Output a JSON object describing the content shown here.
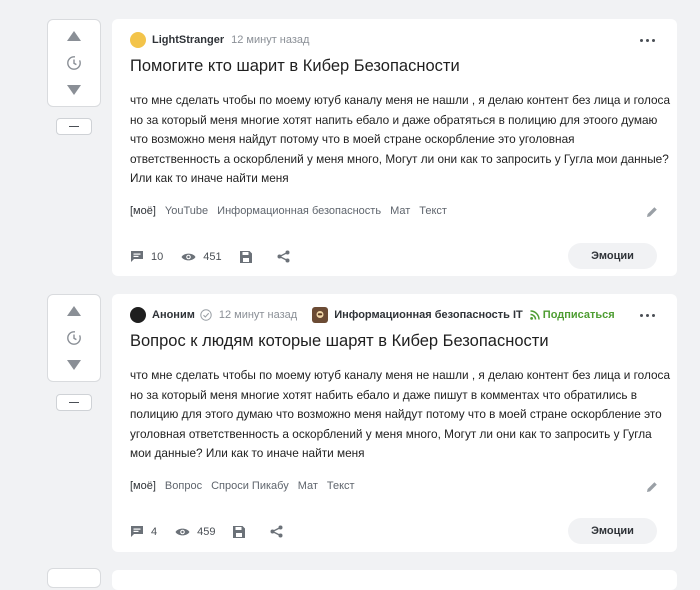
{
  "posts": [
    {
      "author": "LightStranger",
      "time": "12 минут назад",
      "title": "Помогите кто шарит в Кибер Безопасности",
      "lines": [
        "что мне сделать чтобы по моему ютуб каналу меня не нашли , я делаю контент без лица и голоса",
        "но за который меня многие хотят напить ебало и даже обратяться в полицию для этоого думаю",
        "что возможно меня найдут потому что в моей стране оскорбление это уголовная",
        "ответственность а оскорблений у меня много, Могут ли они как то запросить у Гугла мои данные?",
        "Или как то иначе найти меня"
      ],
      "tags": [
        "[моё]",
        "YouTube",
        "Информационная безопасность",
        "Мат",
        "Текст"
      ],
      "comments": "10",
      "views": "451",
      "emotions_label": "Эмоции"
    },
    {
      "author": "Аноним",
      "time": "12 минут назад",
      "community": "Информационная безопасность IT",
      "subscribe": "Подписаться",
      "title": "Вопрос к людям которые шарят в Кибер Безопасности",
      "lines": [
        "что мне сделать чтобы по моему ютуб каналу меня не нашли , я делаю контент без лица и голоса",
        "но за который меня многие хотят набить ебало и даже пишут в комментах что обратились в",
        "полицию для этого думаю что возможно меня найдут потому что в моей стране оскорбление это",
        "уголовная ответственность а оскорблений у меня много, Могут ли они как то запросить у Гугла",
        "мои данные? Или как то иначе найти меня"
      ],
      "tags": [
        "[моё]",
        "Вопрос",
        "Спроси Пикабу",
        "Мат",
        "Текст"
      ],
      "comments": "4",
      "views": "459",
      "emotions_label": "Эмоции"
    }
  ],
  "colors": {
    "subscribe": "#4e9d32",
    "background": "#f1f2f4"
  }
}
